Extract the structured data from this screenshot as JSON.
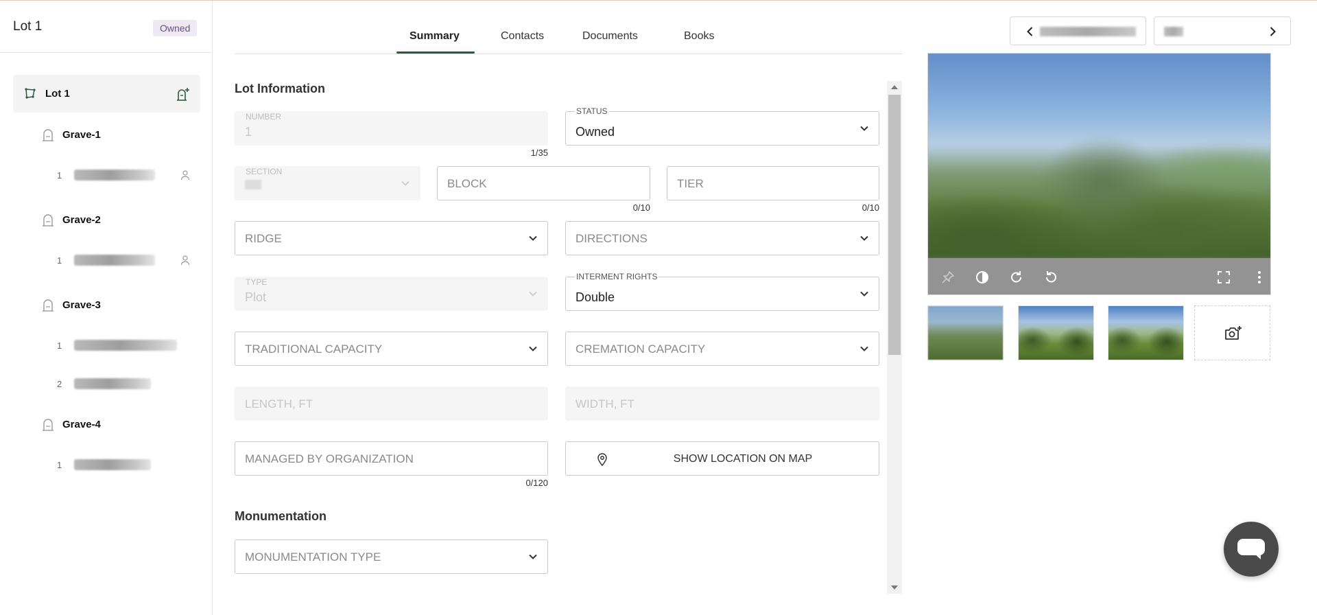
{
  "sidebar": {
    "title": "Lot 1",
    "badge": "Owned",
    "lot": {
      "label": "Lot 1"
    },
    "graves": [
      {
        "label": "Grave-1",
        "occupants": [
          {
            "index": "1",
            "person_icon": true
          }
        ]
      },
      {
        "label": "Grave-2",
        "occupants": [
          {
            "index": "1",
            "person_icon": true
          }
        ]
      },
      {
        "label": "Grave-3",
        "occupants": [
          {
            "index": "1",
            "person_icon": false
          },
          {
            "index": "2",
            "person_icon": false
          }
        ]
      },
      {
        "label": "Grave-4",
        "occupants": [
          {
            "index": "1",
            "person_icon": false
          }
        ]
      }
    ]
  },
  "tabs": [
    {
      "label": "Summary",
      "active": true
    },
    {
      "label": "Contacts",
      "active": false
    },
    {
      "label": "Documents",
      "active": false
    },
    {
      "label": "Books",
      "active": false
    }
  ],
  "lot_info": {
    "title": "Lot Information",
    "number": {
      "label": "NUMBER",
      "value": "1",
      "counter": "1/35"
    },
    "status": {
      "label": "STATUS",
      "value": "Owned"
    },
    "section": {
      "label": "SECTION"
    },
    "block": {
      "placeholder": "BLOCK",
      "counter": "0/10"
    },
    "tier": {
      "placeholder": "TIER",
      "counter": "0/10"
    },
    "ridge": {
      "placeholder": "RIDGE"
    },
    "directions": {
      "placeholder": "DIRECTIONS"
    },
    "type": {
      "label": "TYPE",
      "value": "Plot"
    },
    "interment_rights": {
      "label": "INTERMENT RIGHTS",
      "value": "Double"
    },
    "traditional_capacity": {
      "placeholder": "TRADITIONAL CAPACITY"
    },
    "cremation_capacity": {
      "placeholder": "CREMATION CAPACITY"
    },
    "length": {
      "placeholder": "LENGTH, FT"
    },
    "width": {
      "placeholder": "WIDTH, FT"
    },
    "managed_by": {
      "placeholder": "MANAGED BY ORGANIZATION",
      "counter": "0/120"
    },
    "map_button": "SHOW LOCATION ON MAP"
  },
  "monumentation": {
    "title": "Monumentation",
    "type": {
      "placeholder": "MONUMENTATION TYPE"
    }
  },
  "photo_toolbar": [
    "pin-icon",
    "contrast-icon",
    "rotate-right-icon",
    "rotate-left-icon",
    "fullscreen-icon",
    "more-vertical-icon"
  ],
  "colors": {
    "accent_green": "#2d5a3f",
    "badge_bg": "#eee9f3",
    "badge_text": "#6b4f8c",
    "chat_button": "#4a4a4a"
  }
}
